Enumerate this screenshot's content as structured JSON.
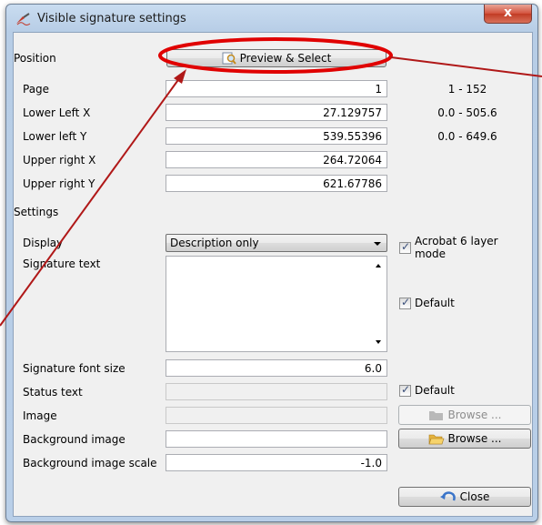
{
  "window": {
    "title": "Visible signature settings",
    "close_glyph": "x"
  },
  "position": {
    "section_label": "Position",
    "preview_button": "Preview & Select",
    "rows": [
      {
        "label": "Page",
        "value": "1",
        "range": "1 - 152"
      },
      {
        "label": "Lower Left X",
        "value": "27.129757",
        "range": "0.0 - 505.6"
      },
      {
        "label": "Lower left Y",
        "value": "539.55396",
        "range": "0.0 - 649.6"
      },
      {
        "label": "Upper right X",
        "value": "264.72064",
        "range": ""
      },
      {
        "label": "Upper right Y",
        "value": "621.67786",
        "range": ""
      }
    ]
  },
  "settings": {
    "section_label": "Settings",
    "display_label": "Display",
    "display_value": "Description only",
    "acrobat_checkbox": "Acrobat 6 layer mode",
    "signature_text_label": "Signature text",
    "signature_text_value": "",
    "default_label_1": "Default",
    "font_size_label": "Signature font size",
    "font_size_value": "6.0",
    "status_text_label": "Status text",
    "default_label_2": "Default",
    "image_label": "Image",
    "browse_disabled": "Browse ...",
    "bg_image_label": "Background image",
    "browse_enabled": "Browse ...",
    "bg_scale_label": "Background image scale",
    "bg_scale_value": "-1.0",
    "close_button": "Close"
  },
  "colors": {
    "annotation_red": "#e00000",
    "arrow_dark_red": "#b01818"
  }
}
